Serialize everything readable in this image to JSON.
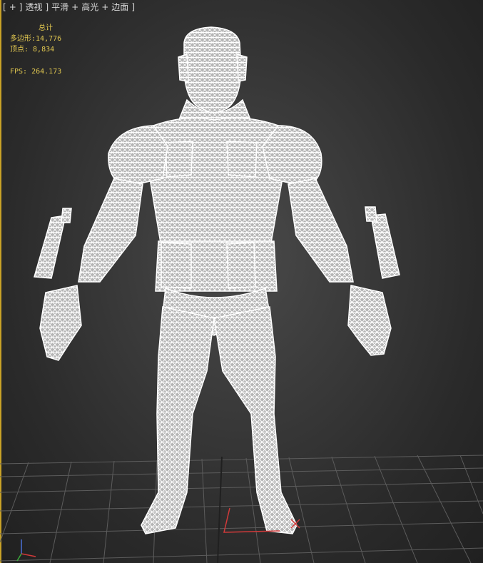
{
  "viewport": {
    "menu": {
      "bracket_open": "[",
      "plus": "+",
      "separator": "]",
      "view_label": "透视",
      "shading_label": "平滑",
      "highlight_label": "高光",
      "edges_label": "边面",
      "bracket_close": "]"
    },
    "stats": {
      "title": "总计",
      "polygons_label": "多边形:",
      "polygons_value": "14,776",
      "vertices_label": "顶点:",
      "vertices_value": "8,834",
      "fps_label": "FPS:",
      "fps_value": "264.173"
    }
  },
  "colors": {
    "stats_text": "#e2c850",
    "wireframe": "#ffffff",
    "grid": "#5a5a5a",
    "viewport_border": "#c9a227",
    "axis_x": "#d23a3a"
  },
  "icons": {
    "gizmo": "transform-gizmo-icon",
    "axis_tripod": "world-axis-icon"
  }
}
